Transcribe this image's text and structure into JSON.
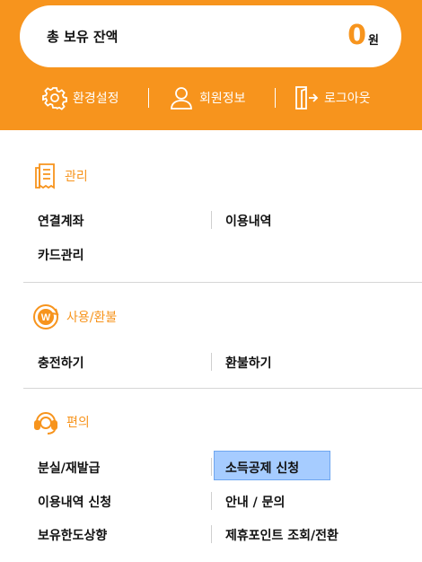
{
  "balance": {
    "label": "총 보유 잔액",
    "amount": "0",
    "unit": "원"
  },
  "quick_menu": [
    {
      "label": "환경설정",
      "icon": "gear-icon"
    },
    {
      "label": "회원정보",
      "icon": "person-icon"
    },
    {
      "label": "로그아웃",
      "icon": "logout-icon"
    }
  ],
  "sections": [
    {
      "title": "관리",
      "icon": "receipt-icon",
      "items": [
        "연결계좌",
        "이용내역",
        "카드관리"
      ]
    },
    {
      "title": "사용/환불",
      "icon": "won-coin-icon",
      "items": [
        "충전하기",
        "환불하기"
      ]
    },
    {
      "title": "편의",
      "icon": "headset-icon",
      "items": [
        "분실/재발급",
        "소득공제 신청",
        "이용내역 신청",
        "안내 / 문의",
        "보유한도상향",
        "제휴포인트 조회/전환"
      ]
    }
  ],
  "colors": {
    "accent": "#f7941d",
    "highlight": "#a6ccff"
  }
}
